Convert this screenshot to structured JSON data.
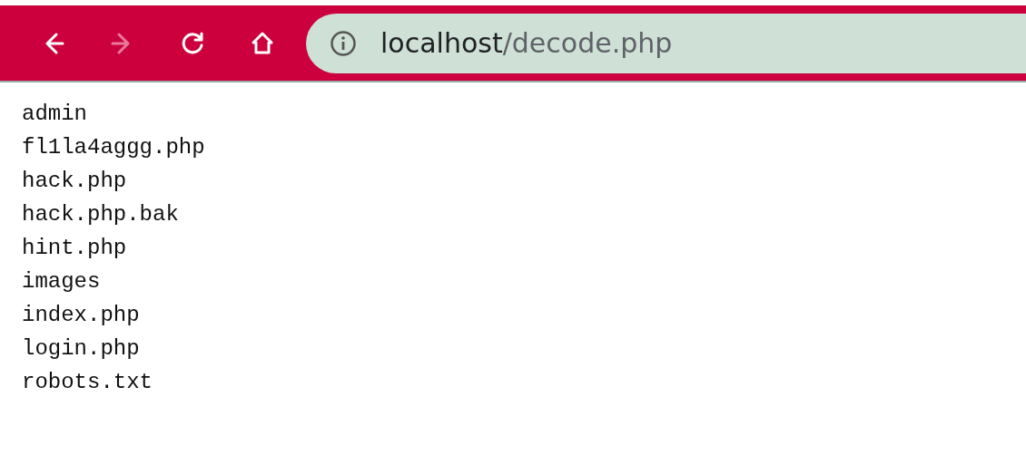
{
  "toolbar": {
    "buttons": [
      {
        "kind": "back",
        "disabled": false
      },
      {
        "kind": "forward",
        "disabled": true
      },
      {
        "kind": "reload",
        "disabled": false
      },
      {
        "kind": "home",
        "disabled": false
      }
    ],
    "address": {
      "host": "localhost",
      "path": "/decode.php"
    }
  },
  "listing": [
    "admin",
    "fl1la4aggg.php",
    "hack.php",
    "hack.php.bak",
    "hint.php",
    "images",
    "index.php",
    "login.php",
    "robots.txt"
  ]
}
